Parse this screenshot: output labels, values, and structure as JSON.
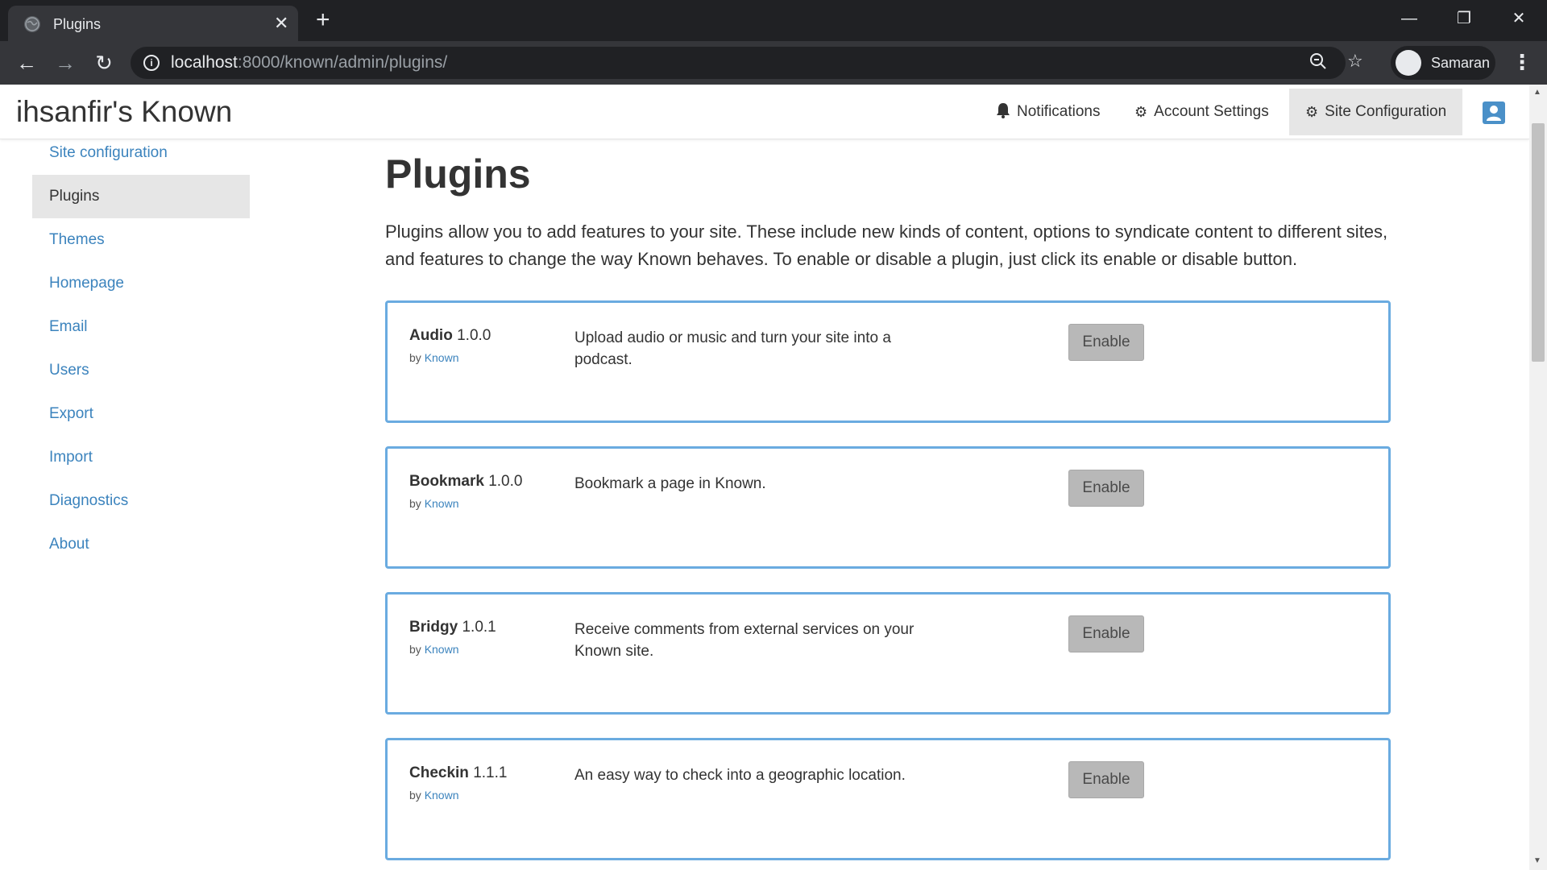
{
  "browser": {
    "tab_title": "Plugins",
    "tab_close": "✕",
    "new_tab": "+",
    "url_host": "localhost",
    "url_path": ":8000/known/admin/plugins/",
    "profile_name": "Samaran",
    "icons": [
      "globe-icon",
      "back-arrow-icon",
      "forward-arrow-icon",
      "reload-icon",
      "info-icon",
      "zoom-icon",
      "star-icon",
      "incognito-icon",
      "menu-dots-icon",
      "minimize-icon",
      "restore-icon",
      "close-window-icon"
    ]
  },
  "header": {
    "site_title": "ihsanfir's Known",
    "nav": [
      {
        "label": "Notifications",
        "icon": "bell-icon"
      },
      {
        "label": "Account Settings",
        "icon": "gear-icon"
      },
      {
        "label": "Site Configuration",
        "icon": "gears-icon",
        "active": true
      }
    ]
  },
  "sidebar": {
    "items": [
      {
        "label": "Site configuration"
      },
      {
        "label": "Plugins",
        "active": true
      },
      {
        "label": "Themes"
      },
      {
        "label": "Homepage"
      },
      {
        "label": "Email"
      },
      {
        "label": "Users"
      },
      {
        "label": "Export"
      },
      {
        "label": "Import"
      },
      {
        "label": "Diagnostics"
      },
      {
        "label": "About"
      }
    ]
  },
  "main": {
    "title": "Plugins",
    "intro": "Plugins allow you to add features to your site. These include new kinds of content, options to syndicate content to different sites, and features to change the way Known behaves. To enable or disable a plugin, just click its enable or disable button.",
    "plugins": [
      {
        "name": "Audio",
        "version": "1.0.0",
        "by": "by",
        "author": "Known",
        "description": "Upload audio or music and turn your site into a podcast.",
        "button": "Enable"
      },
      {
        "name": "Bookmark",
        "version": "1.0.0",
        "by": "by",
        "author": "Known",
        "description": "Bookmark a page in Known.",
        "button": "Enable"
      },
      {
        "name": "Bridgy",
        "version": "1.0.1",
        "by": "by",
        "author": "Known",
        "description": "Receive comments from external services on your Known site.",
        "button": "Enable"
      },
      {
        "name": "Checkin",
        "version": "1.1.1",
        "by": "by",
        "author": "Known",
        "description": "An easy way to check into a geographic location.",
        "button": "Enable"
      }
    ]
  },
  "colors": {
    "link": "#3b83bd",
    "plugin_border": "#6aabe0",
    "button_bg": "#b8b8b8",
    "chrome_dark": "#202124",
    "chrome_toolbar": "#35363a"
  }
}
